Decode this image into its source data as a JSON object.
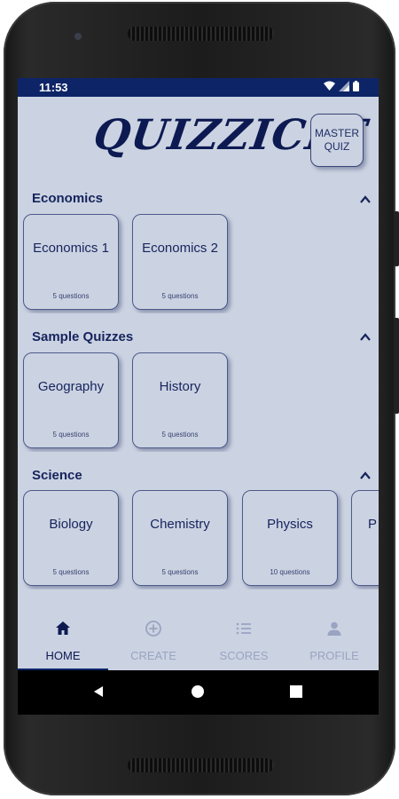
{
  "status": {
    "time": "11:53"
  },
  "app": {
    "title": "QUIZZICLE",
    "master_quiz": "MASTER\nQUIZ"
  },
  "sections": [
    {
      "title": "Economics",
      "quizzes": [
        {
          "name": "Economics 1",
          "count": "5 questions"
        },
        {
          "name": "Economics 2",
          "count": "5 questions"
        }
      ]
    },
    {
      "title": "Sample Quizzes",
      "quizzes": [
        {
          "name": "Geography",
          "count": "5 questions"
        },
        {
          "name": "History",
          "count": "5 questions"
        }
      ]
    },
    {
      "title": "Science",
      "quizzes": [
        {
          "name": "Biology",
          "count": "5 questions"
        },
        {
          "name": "Chemistry",
          "count": "5 questions"
        },
        {
          "name": "Physics",
          "count": "10 questions"
        },
        {
          "name": "P",
          "count": ""
        }
      ]
    }
  ],
  "nav": {
    "home": "HOME",
    "create": "CREATE",
    "scores": "SCORES",
    "profile": "PROFILE"
  },
  "colors": {
    "accent": "#0d2467",
    "background": "#cbd3e2",
    "text": "#16235c",
    "inactive": "#9aa3c2"
  }
}
